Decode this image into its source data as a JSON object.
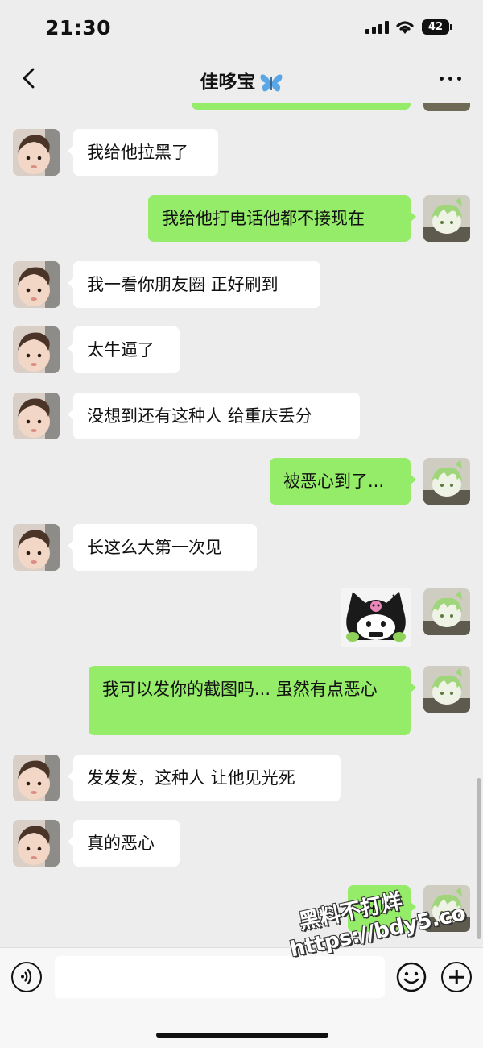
{
  "status_bar": {
    "time": "21:30",
    "battery": "42",
    "icons": [
      "signal-icon",
      "wifi-icon",
      "battery-icon"
    ]
  },
  "header": {
    "title": "佳哆宝",
    "title_emoji": "butterfly-icon",
    "back_icon": "chevron-left-icon",
    "more_icon": "more-dots-icon"
  },
  "messages": [
    {
      "side": "in",
      "text": "我给他拉黑了"
    },
    {
      "side": "out",
      "text": "我给他打电话他都不接现在"
    },
    {
      "side": "in",
      "text": "我一看你朋友圈 正好刷到"
    },
    {
      "side": "in",
      "text": "太牛逼了"
    },
    {
      "side": "in",
      "text": "没想到还有这种人 给重庆丢分"
    },
    {
      "side": "out",
      "text": "被恶心到了..."
    },
    {
      "side": "in",
      "text": "长这么大第一次见"
    },
    {
      "side": "out",
      "type": "sticker",
      "sticker": "kuromi-sticker"
    },
    {
      "side": "out",
      "text": "我可以发你的截图吗... 虽然有点恶心"
    },
    {
      "side": "in",
      "text": "发发发，这种人 让他见光死"
    },
    {
      "side": "in",
      "text": "真的恶心"
    },
    {
      "side": "out",
      "text": "好!"
    }
  ],
  "input_bar": {
    "voice_icon": "voice-icon",
    "emoji_icon": "emoji-icon",
    "plus_icon": "plus-icon",
    "placeholder": ""
  },
  "watermark": {
    "line1": "黑料不打烊",
    "line2": "https://bdy5.co"
  },
  "colors": {
    "background": "#ededed",
    "incoming_bubble": "#ffffff",
    "outgoing_bubble": "#95ec69"
  }
}
